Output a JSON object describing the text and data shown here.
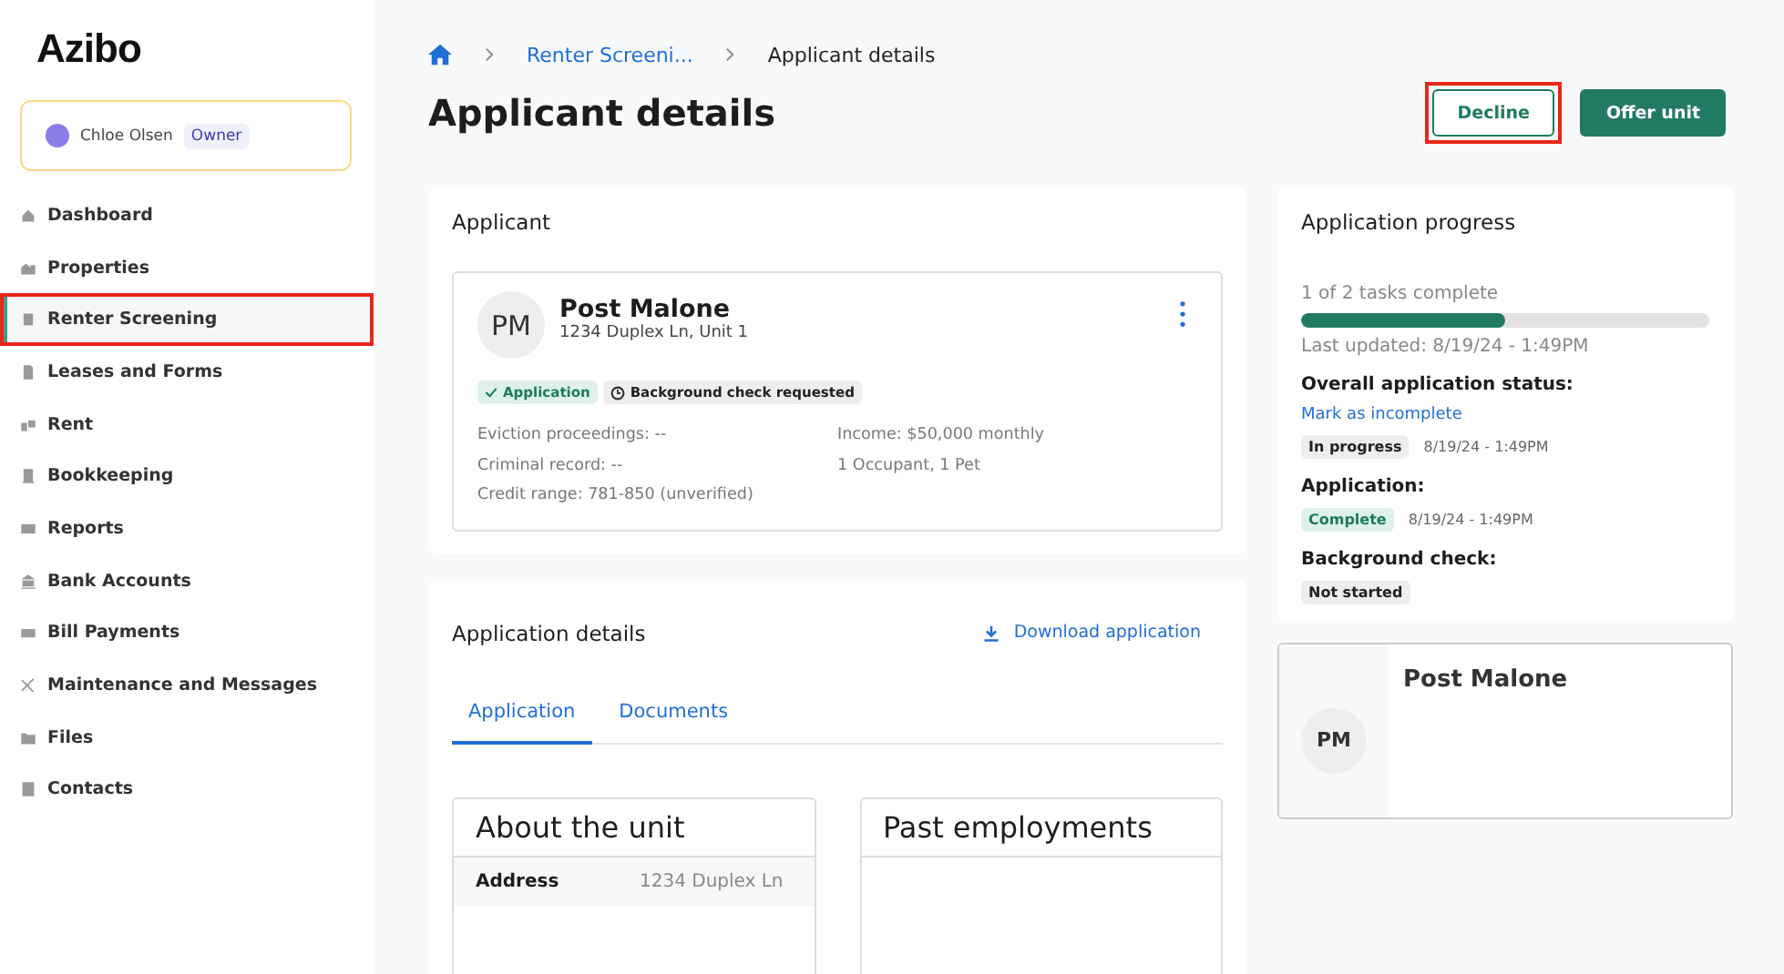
{
  "sidebar": {
    "logo": "Azibo",
    "user": {
      "name": "Chloe Olsen",
      "role": "Owner"
    },
    "items": [
      {
        "label": "Dashboard",
        "selected": false,
        "highlighted": false
      },
      {
        "label": "Properties",
        "selected": false,
        "highlighted": false
      },
      {
        "label": "Renter Screening",
        "selected": true,
        "highlighted": true
      },
      {
        "label": "Leases and Forms",
        "selected": false,
        "highlighted": false
      },
      {
        "label": "Rent",
        "selected": false,
        "highlighted": false
      },
      {
        "label": "Bookkeeping",
        "selected": false,
        "highlighted": false
      },
      {
        "label": "Reports",
        "selected": false,
        "highlighted": false
      },
      {
        "label": "Bank Accounts",
        "selected": false,
        "highlighted": false
      },
      {
        "label": "Bill Payments",
        "selected": false,
        "highlighted": false
      },
      {
        "label": "Maintenance and Messages",
        "selected": false,
        "highlighted": false
      },
      {
        "label": "Files",
        "selected": false,
        "highlighted": false
      },
      {
        "label": "Contacts",
        "selected": false,
        "highlighted": false
      }
    ]
  },
  "breadcrumb": [
    "Renter Screeni...",
    "Applicant details"
  ],
  "header": {
    "title": "Applicant details",
    "buttons": [
      {
        "label": "Decline",
        "kind": "outline",
        "highlighted": true
      },
      {
        "label": "Offer unit",
        "kind": "primary",
        "highlighted": false
      }
    ]
  },
  "applicant": {
    "title": "Applicant",
    "initials": "PM",
    "name": "Post Malone",
    "address": "1234 Duplex Ln, Unit 1",
    "tags": [
      {
        "label": "Application",
        "kind": "success"
      },
      {
        "label": "Background check requested",
        "kind": "pending"
      }
    ],
    "details_left": [
      "Eviction proceedings: --",
      "Criminal record: --",
      "Credit range: 781-850 (unverified)"
    ],
    "details_right": [
      "Income: $50,000 monthly",
      "1 Occupant, 1 Pet"
    ]
  },
  "details": {
    "title": "Application details",
    "download": "Download application",
    "tabs": [
      {
        "label": "Application",
        "selected": true
      },
      {
        "label": "Documents",
        "selected": false
      }
    ],
    "about": {
      "title": "About the unit",
      "rows": [
        {
          "label": "Address",
          "value": "1234 Duplex Ln"
        }
      ]
    },
    "employments": {
      "title": "Past employments"
    }
  },
  "progress": {
    "title": "Application progress",
    "tasks": "1 of 2 tasks complete",
    "level": 0.5,
    "updated": "Last updated: 8/19/24 - 1:49PM",
    "sections": [
      {
        "heading": "Overall application status:",
        "link": "Mark as incomplete",
        "badge": {
          "label": "In progress",
          "kind": "neutral"
        },
        "time": "8/19/24 - 1:49PM"
      },
      {
        "heading": "Application:",
        "badge": {
          "label": "Complete",
          "kind": "success"
        },
        "time": "8/19/24 - 1:49PM"
      },
      {
        "heading": "Background check:",
        "badge": {
          "label": "Not started",
          "kind": "neutral"
        }
      }
    ]
  },
  "contact": {
    "initials": "PM",
    "name": "Post Malone"
  }
}
